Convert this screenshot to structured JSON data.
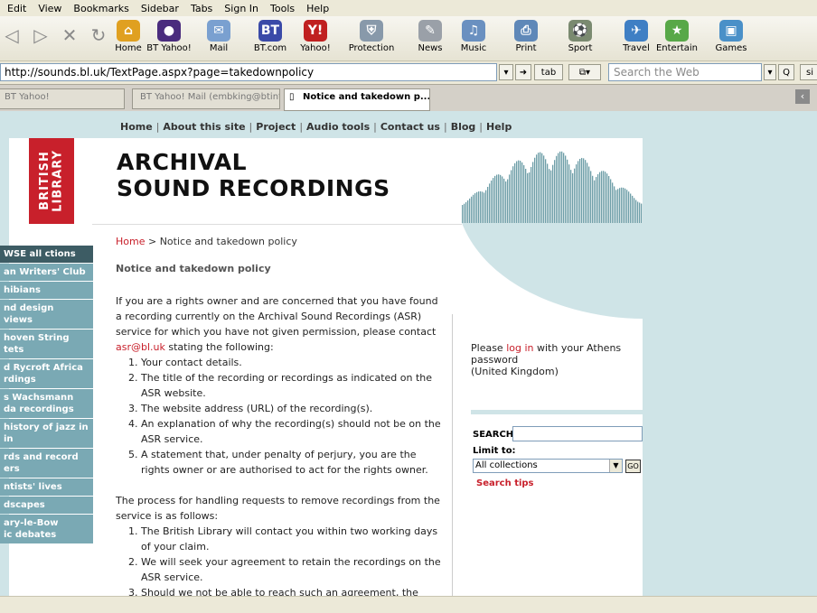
{
  "menu": [
    "Edit",
    "View",
    "Bookmarks",
    "Sidebar",
    "Tabs",
    "Sign In",
    "Tools",
    "Help"
  ],
  "toolbar": {
    "items": [
      {
        "label": "Home",
        "icon": "home-icon",
        "color": "#e0a020",
        "glyph": "⌂"
      },
      {
        "label": "BT Yahoo!",
        "icon": "bt-yahoo-icon",
        "color": "#4a2c7e",
        "glyph": "●"
      },
      {
        "label": "Mail",
        "icon": "mail-icon",
        "color": "#7aa0d0",
        "glyph": "✉"
      },
      {
        "label": "BT.com",
        "icon": "bt-com-icon",
        "color": "#3a4aa8",
        "glyph": "BT"
      },
      {
        "label": "Yahoo!",
        "icon": "yahoo-icon",
        "color": "#c02020",
        "glyph": "Y!"
      },
      {
        "label": "Protection",
        "icon": "protection-icon",
        "color": "#8899aa",
        "glyph": "⛨"
      },
      {
        "label": "News",
        "icon": "news-icon",
        "color": "#9aa0a8",
        "glyph": "✎"
      },
      {
        "label": "Music",
        "icon": "music-icon",
        "color": "#6a90c0",
        "glyph": "♫"
      },
      {
        "label": "Print",
        "icon": "print-icon",
        "color": "#5f88b8",
        "glyph": "⎙"
      },
      {
        "label": "Sport",
        "icon": "sport-icon",
        "color": "#7a8a70",
        "glyph": "⚽"
      },
      {
        "label": "Travel",
        "icon": "travel-icon",
        "color": "#3f7fc4",
        "glyph": "✈"
      },
      {
        "label": "Entertain",
        "icon": "entertain-icon",
        "color": "#58a848",
        "glyph": "★"
      },
      {
        "label": "Games",
        "icon": "games-icon",
        "color": "#4a90c8",
        "glyph": "▣"
      }
    ]
  },
  "address": {
    "url": "http://sounds.bl.uk/TextPage.aspx?page=takedownpolicy",
    "tab_button": "tab",
    "search_placeholder": "Search the Web",
    "search_btn": "Q",
    "extra_btn": "si"
  },
  "tabs": [
    {
      "label": "BT Yahoo!"
    },
    {
      "label": "BT Yahoo! Mail (embking@btint..."
    },
    {
      "label": "Notice and takedown p..."
    }
  ],
  "page": {
    "topnav": [
      "Home",
      "About this site",
      "Project",
      "Audio tools",
      "Contact us",
      "Blog",
      "Help"
    ],
    "logo_line1": "BRITISH",
    "logo_line2": "LIBRARY",
    "title_line1": "ARCHIVAL",
    "title_line2": "SOUND RECORDINGS",
    "breadcrumb_home": "Home",
    "breadcrumb_sep": " > ",
    "breadcrumb_current": "Notice and takedown policy",
    "heading": "Notice and takedown policy",
    "intro_pre": "If you are a rights owner and are concerned that you have found a recording currently on the Archival Sound Recordings (ASR) service for which you have not given permission, please contact ",
    "intro_email": "asr@bl.uk",
    "intro_post": " stating the following:",
    "list1": [
      "Your contact details.",
      "The title of the recording or recordings as indicated on the ASR website.",
      "The website address (URL) of the recording(s).",
      "An explanation of why the recording(s) should not be on the ASR service.",
      "A statement that, under penalty of perjury, you are the rights owner or are authorised to act for the rights owner."
    ],
    "para2": "The process for handling requests to remove recordings from the service is as follows:",
    "list2": [
      "The British Library will contact you within two working days of your claim.",
      "We will seek your agreement to retain the recordings on the ASR service.",
      "Should we not be able to reach such an agreement, the"
    ]
  },
  "sidebar": {
    "items": [
      {
        "label": "WSE all ctions",
        "line2": ""
      },
      {
        "label": "an Writers' Club",
        "line2": ""
      },
      {
        "label": "hibians",
        "line2": ""
      },
      {
        "label": "nd design",
        "line2": "views"
      },
      {
        "label": "hoven String",
        "line2": "tets"
      },
      {
        "label": "d Rycroft Africa",
        "line2": "rdings"
      },
      {
        "label": "s Wachsmann",
        "line2": "da recordings"
      },
      {
        "label": "history of jazz in",
        "line2": "in"
      },
      {
        "label": "rds and record",
        "line2": "ers"
      },
      {
        "label": "ntists' lives",
        "line2": ""
      },
      {
        "label": "dscapes",
        "line2": ""
      },
      {
        "label": "ary-le-Bow",
        "line2": "ic debates"
      }
    ]
  },
  "login": {
    "pre": "Please ",
    "link": "log in",
    "post": " with your Athens",
    "line2": "password",
    "line3": "(United Kingdom)"
  },
  "search": {
    "label": "SEARCH",
    "limit_label": "Limit to:",
    "limit_value": "All collections",
    "go": "GO",
    "tips": "Search tips"
  }
}
